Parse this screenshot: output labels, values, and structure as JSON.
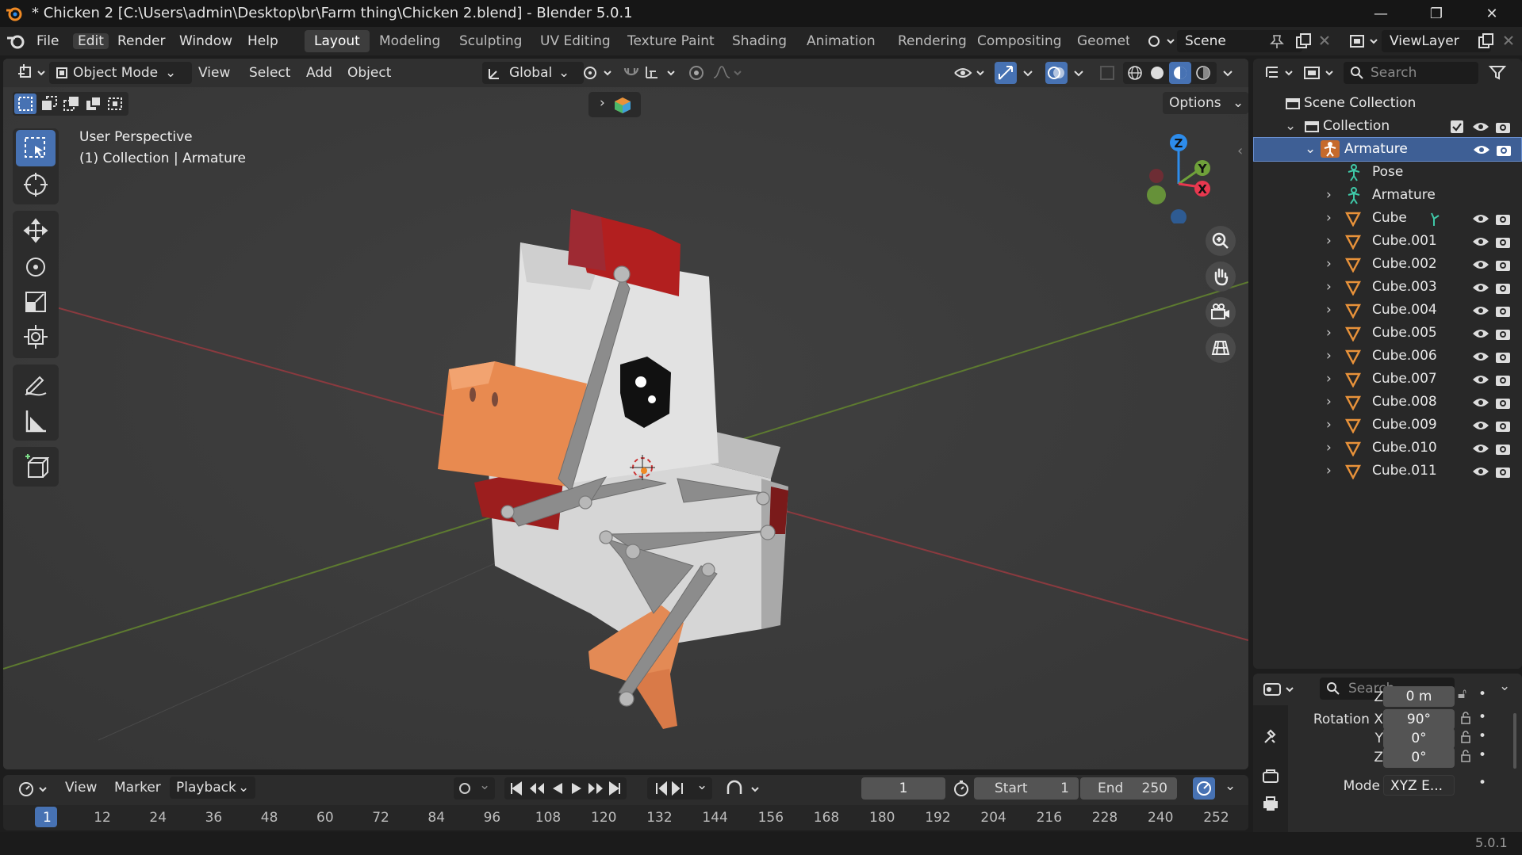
{
  "titlebar": {
    "title": "* Chicken 2 [C:\\Users\\admin\\Desktop\\br\\Farm thing\\Chicken 2.blend] - Blender 5.0.1",
    "minimize": "—",
    "maximize": "❐",
    "close": "✕"
  },
  "menu": [
    "File",
    "Edit",
    "Render",
    "Window",
    "Help"
  ],
  "workspaces": [
    "Layout",
    "Modeling",
    "Sculpting",
    "UV Editing",
    "Texture Paint",
    "Shading",
    "Animation",
    "Rendering",
    "Compositing",
    "Geometr"
  ],
  "scene_name": "Scene",
  "view_layer": "ViewLayer",
  "viewport_header": {
    "mode": "Object Mode",
    "menus": [
      "View",
      "Select",
      "Add",
      "Object"
    ],
    "transform_orientation": "Global",
    "options": "Options"
  },
  "viewport_overlay": {
    "perspective": "User Perspective",
    "context": "(1) Collection | Armature"
  },
  "gizmo_axes": {
    "z": "Z",
    "y": "Y",
    "x": "X"
  },
  "colors": {
    "accent": "#4772b3",
    "selected_row": "#3e5f95",
    "object_icon": "#e8923a",
    "armature_icon": "#3fc8a8",
    "axis_x": "#e8384f",
    "axis_y": "#6fa13a",
    "axis_z": "#2d8ceb"
  },
  "outliner": {
    "search_placeholder": "Search",
    "scene_collection": "Scene Collection",
    "collection": "Collection",
    "selected": "Armature",
    "pose": "Pose",
    "armature_data": "Armature",
    "objects": [
      "Cube",
      "Cube.001",
      "Cube.002",
      "Cube.003",
      "Cube.004",
      "Cube.005",
      "Cube.006",
      "Cube.007",
      "Cube.008",
      "Cube.009",
      "Cube.010",
      "Cube.011"
    ]
  },
  "properties": {
    "search_placeholder": "Search",
    "location_z_label": "Z",
    "location_z": "0 m",
    "rotation_label": "Rotation X",
    "rotation_x": "90°",
    "rotation_y_label": "Y",
    "rotation_y": "0°",
    "rotation_z_label": "Z",
    "rotation_z": "0°",
    "mode_label": "Mode",
    "mode_value": "XYZ E..."
  },
  "timeline": {
    "menus": [
      "View",
      "Marker"
    ],
    "playback": "Playback",
    "current_frame": "1",
    "start_label": "Start",
    "start": "1",
    "end_label": "End",
    "end": "250",
    "ticks": [
      "1",
      "12",
      "24",
      "36",
      "48",
      "60",
      "72",
      "84",
      "96",
      "108",
      "120",
      "132",
      "144",
      "156",
      "168",
      "180",
      "192",
      "204",
      "216",
      "228",
      "240",
      "252"
    ]
  },
  "status": {
    "version": "5.0.1"
  }
}
